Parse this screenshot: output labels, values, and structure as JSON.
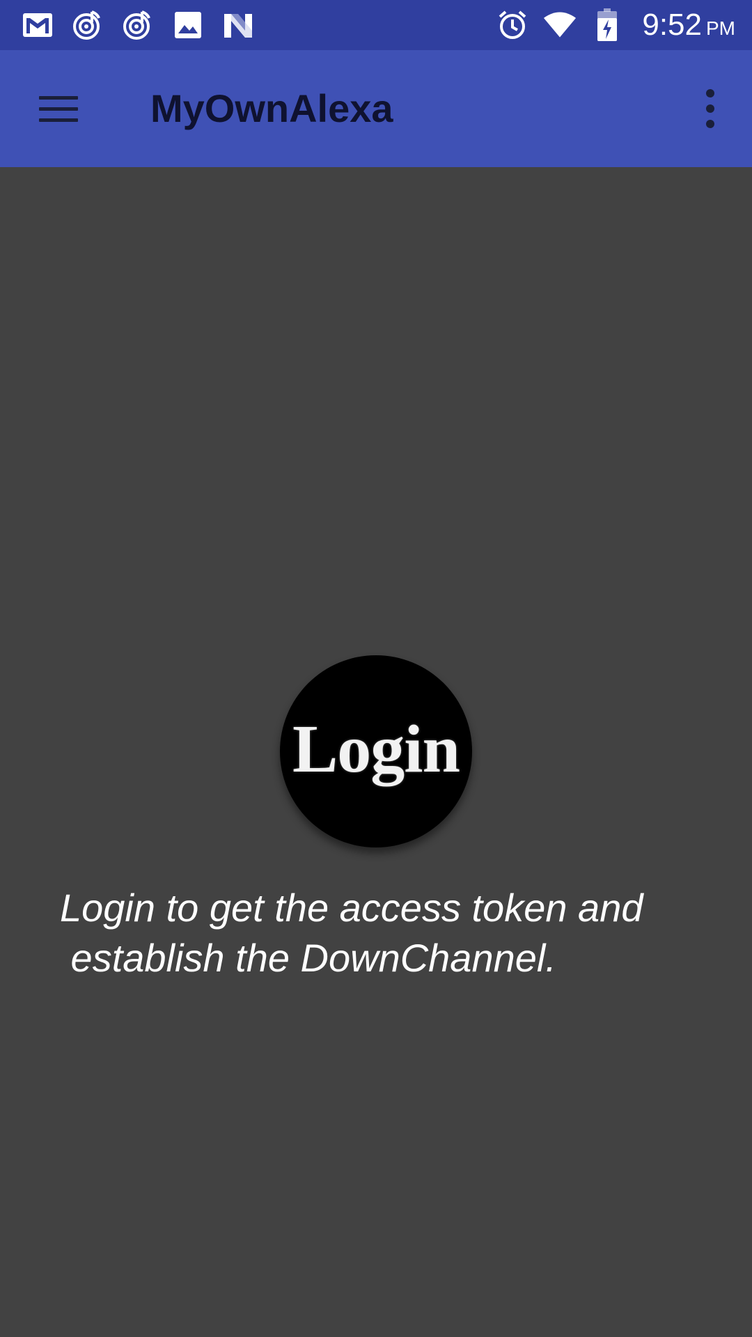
{
  "status_bar": {
    "time": "9:52",
    "ampm": "PM",
    "left_icons": [
      "gmail-icon",
      "music-note-icon",
      "music-note-icon",
      "image-icon",
      "n-logo-icon"
    ],
    "right_icons": [
      "alarm-icon",
      "wifi-icon",
      "battery-charging-icon"
    ]
  },
  "app_bar": {
    "title": "MyOwnAlexa",
    "menu_icon": "hamburger-menu-icon",
    "overflow_icon": "more-vertical-icon"
  },
  "main": {
    "login_label": "Login",
    "message_line1": "Login to get the access token and",
    "message_line2": " establish the DownChannel."
  },
  "colors": {
    "status_bar": "#303f9f",
    "app_bar": "#3f51b5",
    "background": "#424242",
    "login_circle": "#000000"
  }
}
